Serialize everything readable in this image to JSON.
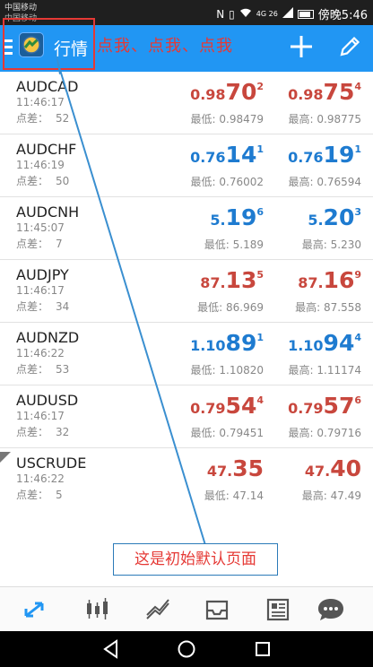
{
  "status_bar": {
    "carrier_primary": "中国移动",
    "carrier_secondary": "中国移动",
    "signal_text": "4G 26",
    "time_text": "傍晚5:46"
  },
  "toolbar": {
    "title": "行情",
    "overlay_annotation": "点我、点我、点我"
  },
  "quotes_list": {
    "spread_label": "点差：",
    "rows": [
      {
        "symbol": "AUDCAD",
        "time": "11:46:17",
        "spread": "52",
        "color": "red",
        "bid": {
          "small": "0.98",
          "big": "70",
          "sup": "2"
        },
        "ask": {
          "small": "0.98",
          "big": "75",
          "sup": "4"
        },
        "low": "最低: 0.98479",
        "high": "最高: 0.98775"
      },
      {
        "symbol": "AUDCHF",
        "time": "11:46:19",
        "spread": "50",
        "color": "blue",
        "bid": {
          "small": "0.76",
          "big": "14",
          "sup": "1"
        },
        "ask": {
          "small": "0.76",
          "big": "19",
          "sup": "1"
        },
        "low": "最低: 0.76002",
        "high": "最高: 0.76594"
      },
      {
        "symbol": "AUDCNH",
        "time": "11:45:07",
        "spread": "7",
        "color": "blue",
        "bid": {
          "small": "5.",
          "big": "19",
          "sup": "6"
        },
        "ask": {
          "small": "5.",
          "big": "20",
          "sup": "3"
        },
        "low": "最低: 5.189",
        "high": "最高: 5.230"
      },
      {
        "symbol": "AUDJPY",
        "time": "11:46:17",
        "spread": "34",
        "color": "red",
        "bid": {
          "small": "87.",
          "big": "13",
          "sup": "5"
        },
        "ask": {
          "small": "87.",
          "big": "16",
          "sup": "9"
        },
        "low": "最低: 86.969",
        "high": "最高: 87.558"
      },
      {
        "symbol": "AUDNZD",
        "time": "11:46:22",
        "spread": "53",
        "color": "blue",
        "bid": {
          "small": "1.10",
          "big": "89",
          "sup": "1"
        },
        "ask": {
          "small": "1.10",
          "big": "94",
          "sup": "4"
        },
        "low": "最低: 1.10820",
        "high": "最高: 1.11174"
      },
      {
        "symbol": "AUDUSD",
        "time": "11:46:17",
        "spread": "32",
        "color": "red",
        "bid": {
          "small": "0.79",
          "big": "54",
          "sup": "4"
        },
        "ask": {
          "small": "0.79",
          "big": "57",
          "sup": "6"
        },
        "low": "最低: 0.79451",
        "high": "最高: 0.79716"
      },
      {
        "symbol": "USCRUDE",
        "time": "11:46:22",
        "spread": "5",
        "color": "red",
        "bid": {
          "small": "47.",
          "big": "35",
          "sup": ""
        },
        "ask": {
          "small": "47.",
          "big": "40",
          "sup": ""
        },
        "low": "最低: 47.14",
        "high": "最高: 47.49"
      }
    ]
  },
  "annotation": {
    "text": "这是初始默认页面"
  },
  "bottom_nav": {
    "items": [
      "quotes-icon",
      "chart-icon",
      "trade-icon",
      "history-icon",
      "news-icon",
      "messages-icon"
    ],
    "active": "quotes-icon",
    "active_color": "#2196f3",
    "inactive_color": "#555555"
  },
  "colors": {
    "toolbar": "#2196f3",
    "price_red": "#c8473d",
    "price_blue": "#1e7bd0",
    "annotation_red": "#e53935"
  }
}
